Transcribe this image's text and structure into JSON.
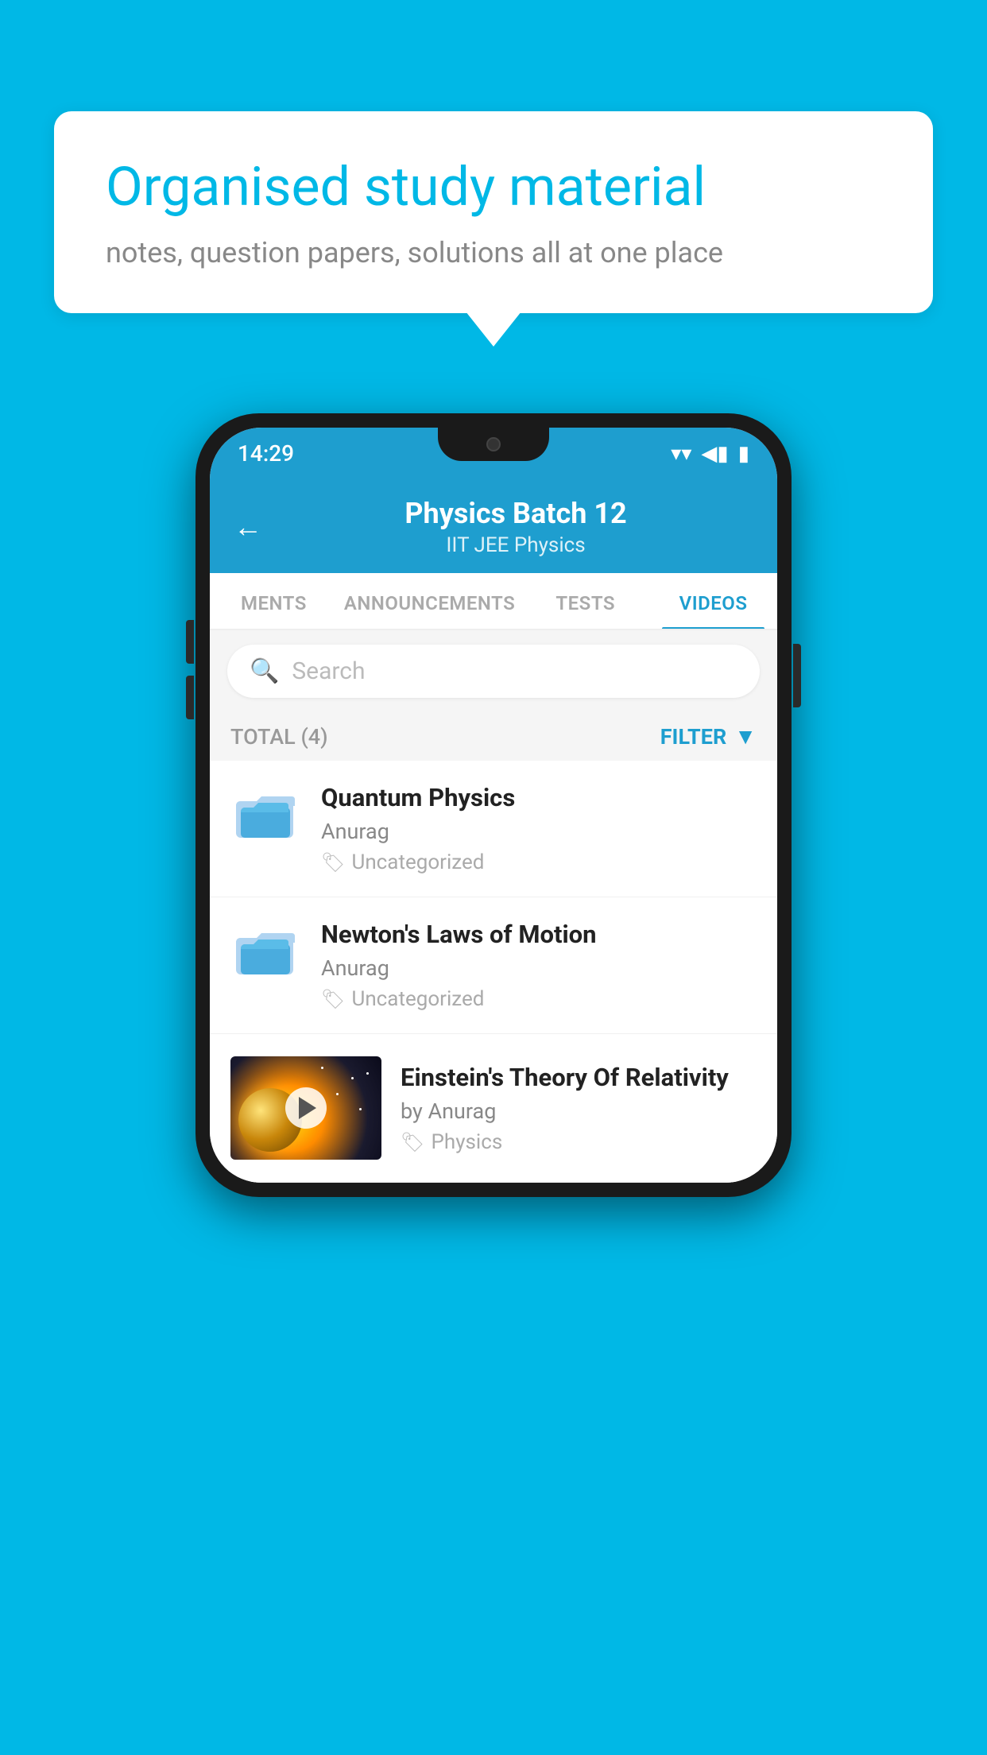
{
  "background_color": "#00b8e6",
  "speech_bubble": {
    "title": "Organised study material",
    "subtitle": "notes, question papers, solutions all at one place"
  },
  "phone": {
    "status_bar": {
      "time": "14:29",
      "wifi_icon": "▼",
      "signal_icon": "▲",
      "battery_icon": "▮"
    },
    "app_header": {
      "back_label": "←",
      "title": "Physics Batch 12",
      "subtitle_tags": "IIT JEE   Physics"
    },
    "tabs": [
      {
        "label": "MENTS",
        "active": false
      },
      {
        "label": "ANNOUNCEMENTS",
        "active": false
      },
      {
        "label": "TESTS",
        "active": false
      },
      {
        "label": "VIDEOS",
        "active": true
      }
    ],
    "search": {
      "placeholder": "Search"
    },
    "filter_row": {
      "total_label": "TOTAL (4)",
      "filter_label": "FILTER"
    },
    "videos": [
      {
        "title": "Quantum Physics",
        "author": "Anurag",
        "tag": "Uncategorized",
        "type": "folder"
      },
      {
        "title": "Newton's Laws of Motion",
        "author": "Anurag",
        "tag": "Uncategorized",
        "type": "folder"
      },
      {
        "title": "Einstein's Theory Of Relativity",
        "author": "by Anurag",
        "tag": "Physics",
        "type": "video"
      }
    ]
  }
}
